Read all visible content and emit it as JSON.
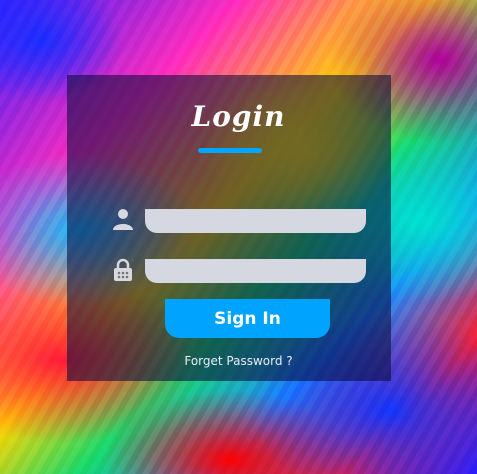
{
  "login_form": {
    "title": "Login",
    "username": {
      "value": "",
      "placeholder": "",
      "icon": "user-icon"
    },
    "password": {
      "value": "",
      "placeholder": "",
      "icon": "lock-icon"
    },
    "submit_label": "Sign In",
    "forgot_label": "Forget Password ?"
  },
  "colors": {
    "accent": "#00a4ff",
    "field_bg": "#d5d8e0",
    "card_bg": "rgba(10,12,60,0.58)"
  }
}
